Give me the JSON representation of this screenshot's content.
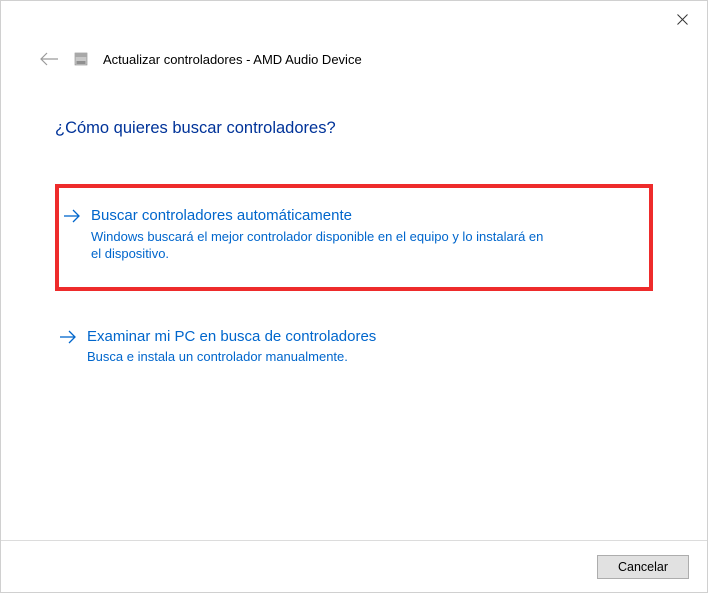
{
  "titlebar": {
    "close_tooltip": "Close"
  },
  "header": {
    "title": "Actualizar controladores - AMD Audio Device"
  },
  "content": {
    "question": "¿Cómo quieres buscar controladores?"
  },
  "options": {
    "auto": {
      "title": "Buscar controladores automáticamente",
      "description": "Windows buscará el mejor controlador disponible en el equipo y lo instalará en el dispositivo."
    },
    "manual": {
      "title": "Examinar mi PC en busca de controladores",
      "description": "Busca e instala un controlador manualmente."
    }
  },
  "footer": {
    "cancel_label": "Cancelar"
  },
  "colors": {
    "link": "#0066cc",
    "heading": "#003399",
    "highlight_border": "#ee2b2b"
  }
}
